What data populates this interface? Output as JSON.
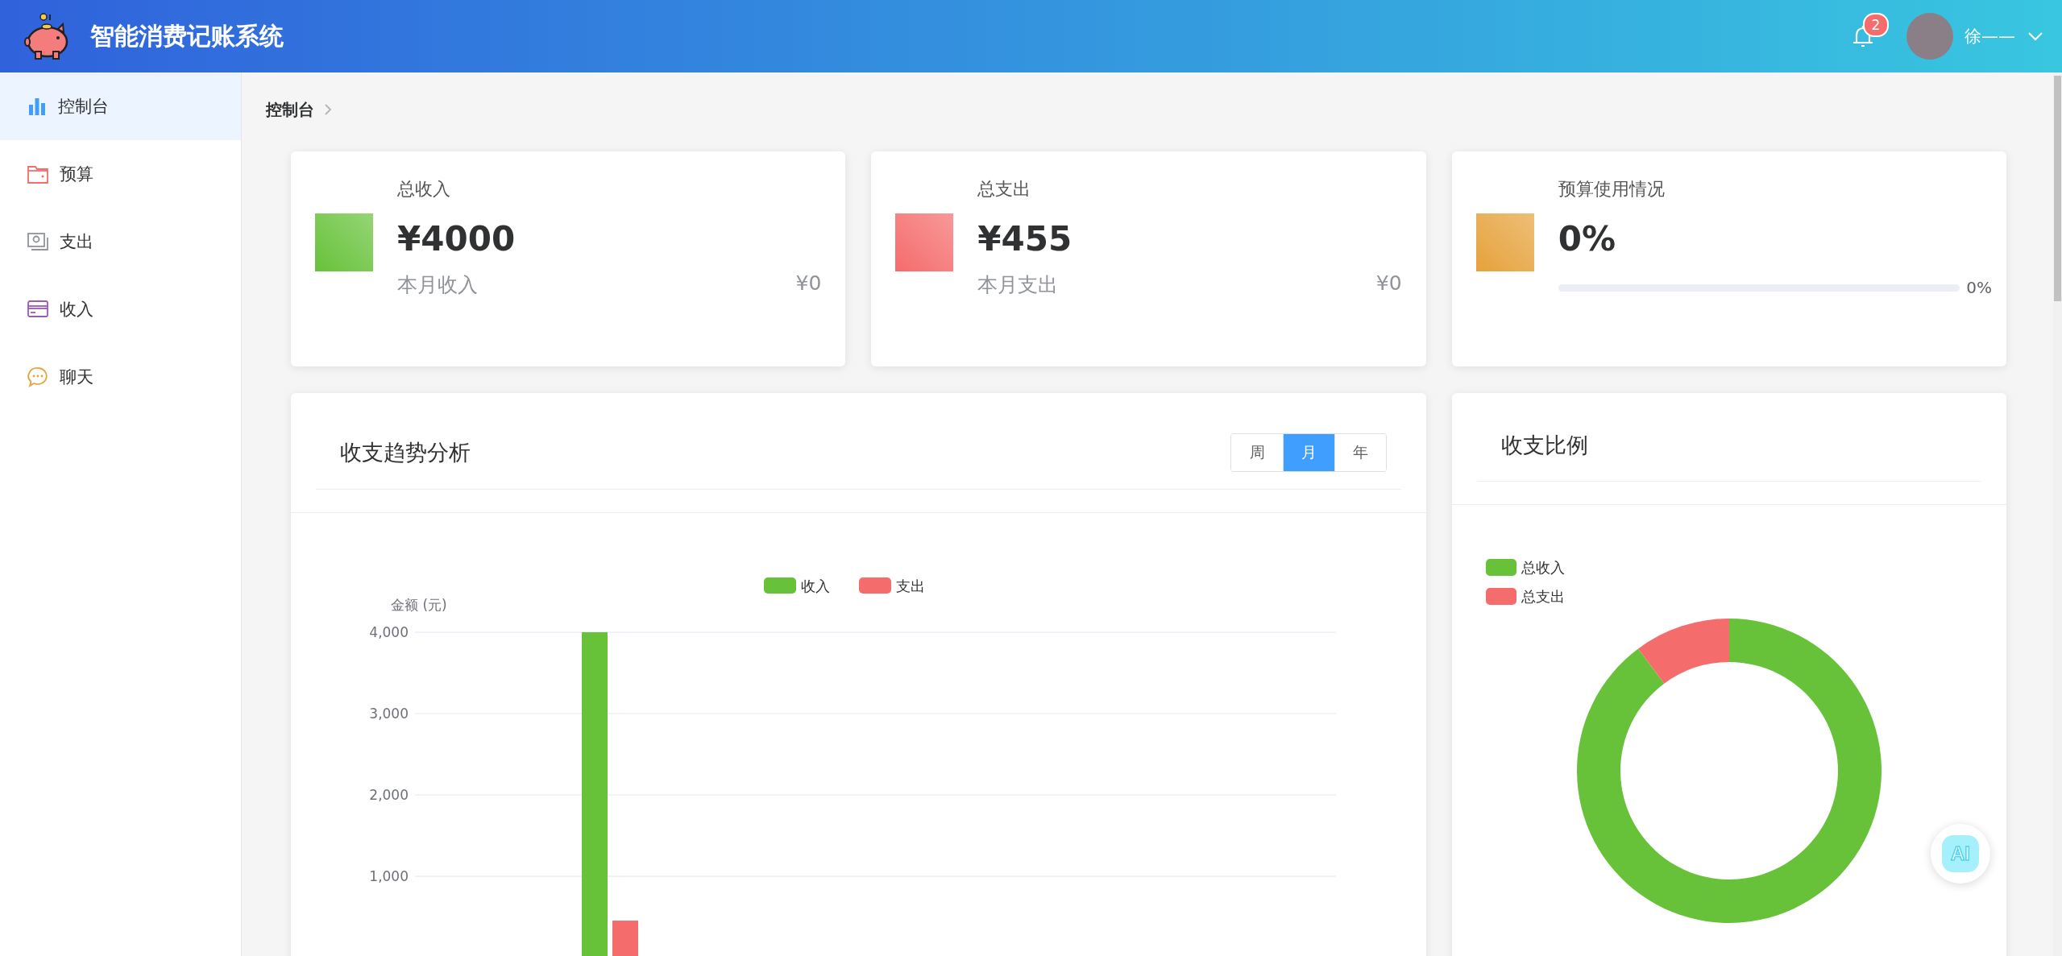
{
  "header": {
    "title": "智能消费记账系统",
    "notifications": "2",
    "user_name": "徐——"
  },
  "sidebar": {
    "items": [
      {
        "label": "控制台",
        "selected": true
      },
      {
        "label": "预算",
        "selected": false
      },
      {
        "label": "支出",
        "selected": false
      },
      {
        "label": "收入",
        "selected": false
      },
      {
        "label": "聊天",
        "selected": false
      }
    ]
  },
  "breadcrumb": [
    "控制台"
  ],
  "stat_cards": [
    {
      "kind": "stat",
      "title": "总收入",
      "value": "¥4000",
      "sub_label": "本月收入",
      "sub_value": "¥0",
      "color": "#67c23a"
    },
    {
      "kind": "stat",
      "title": "总支出",
      "value": "¥455",
      "sub_label": "本月支出",
      "sub_value": "¥0",
      "color": "#f56c6c"
    },
    {
      "kind": "progress",
      "title": "预算使用情况",
      "value": "0%",
      "level": 0,
      "reading": "0%",
      "color": "#e6a23c"
    }
  ],
  "trend_panel": {
    "title": "收支趋势分析",
    "periods": [
      {
        "label": "周",
        "selected": false
      },
      {
        "label": "月",
        "selected": true
      },
      {
        "label": "年",
        "selected": false
      }
    ],
    "chart_data": {
      "type": "bar",
      "grid": true,
      "legend": true,
      "ylabel": "金额 (元)",
      "ylim": [
        0,
        4000
      ],
      "yticks": [
        {
          "value": 1000,
          "label": "1,000"
        },
        {
          "value": 2000,
          "label": "2,000"
        },
        {
          "value": 3000,
          "label": "3,000"
        },
        {
          "value": 4000,
          "label": "4,000"
        }
      ],
      "series": [
        {
          "name": "收入",
          "color": "#67c23a",
          "values": [
            4000
          ]
        },
        {
          "name": "支出",
          "color": "#f56c6c",
          "values": [
            455
          ]
        }
      ]
    }
  },
  "ratio_panel": {
    "title": "收支比例",
    "chart_data": {
      "type": "donut",
      "legend": true,
      "categories": [
        "总收入",
        "总支出"
      ],
      "values": [
        89.8,
        10.2
      ]
    }
  },
  "ai_button": {
    "label": "AI"
  }
}
